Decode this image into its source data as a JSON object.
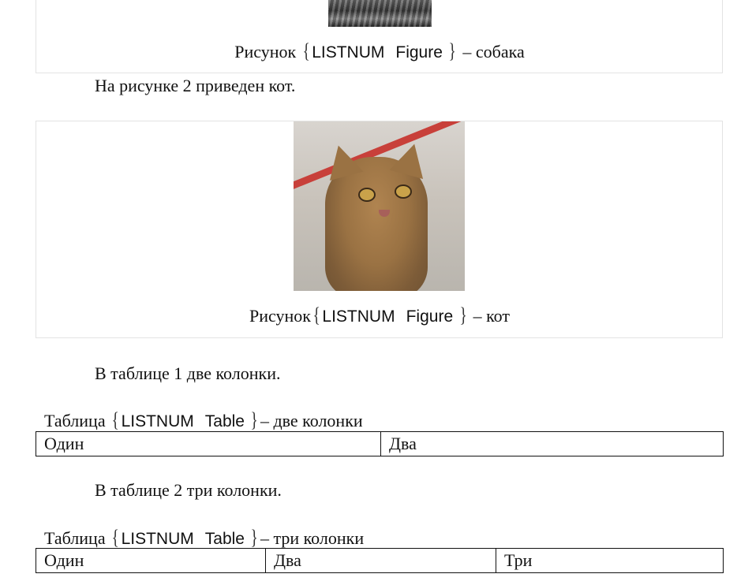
{
  "figure1": {
    "caption_prefix": "Рисунок",
    "field_code": "LISTNUM",
    "field_name": "Figure",
    "caption_suffix": "– собака"
  },
  "para1": "На рисунке 2 приведен кот.",
  "figure2": {
    "caption_prefix": "Рисунок",
    "field_code": "LISTNUM",
    "field_name": "Figure",
    "caption_suffix": "– кот"
  },
  "para2": "В таблице 1 две колонки.",
  "table1": {
    "caption_prefix": "Таблица",
    "field_code": "LISTNUM",
    "field_name": "Table",
    "caption_suffix": "– две колонки",
    "cells": [
      "Один",
      "Два"
    ]
  },
  "para3": "В таблице 2 три колонки.",
  "table2": {
    "caption_prefix": "Таблица",
    "field_code": "LISTNUM",
    "field_name": "Table",
    "caption_suffix": "– три колонки",
    "cells": [
      "Один",
      "Два",
      "Три"
    ]
  },
  "braces": {
    "open": "{",
    "close": "}"
  }
}
